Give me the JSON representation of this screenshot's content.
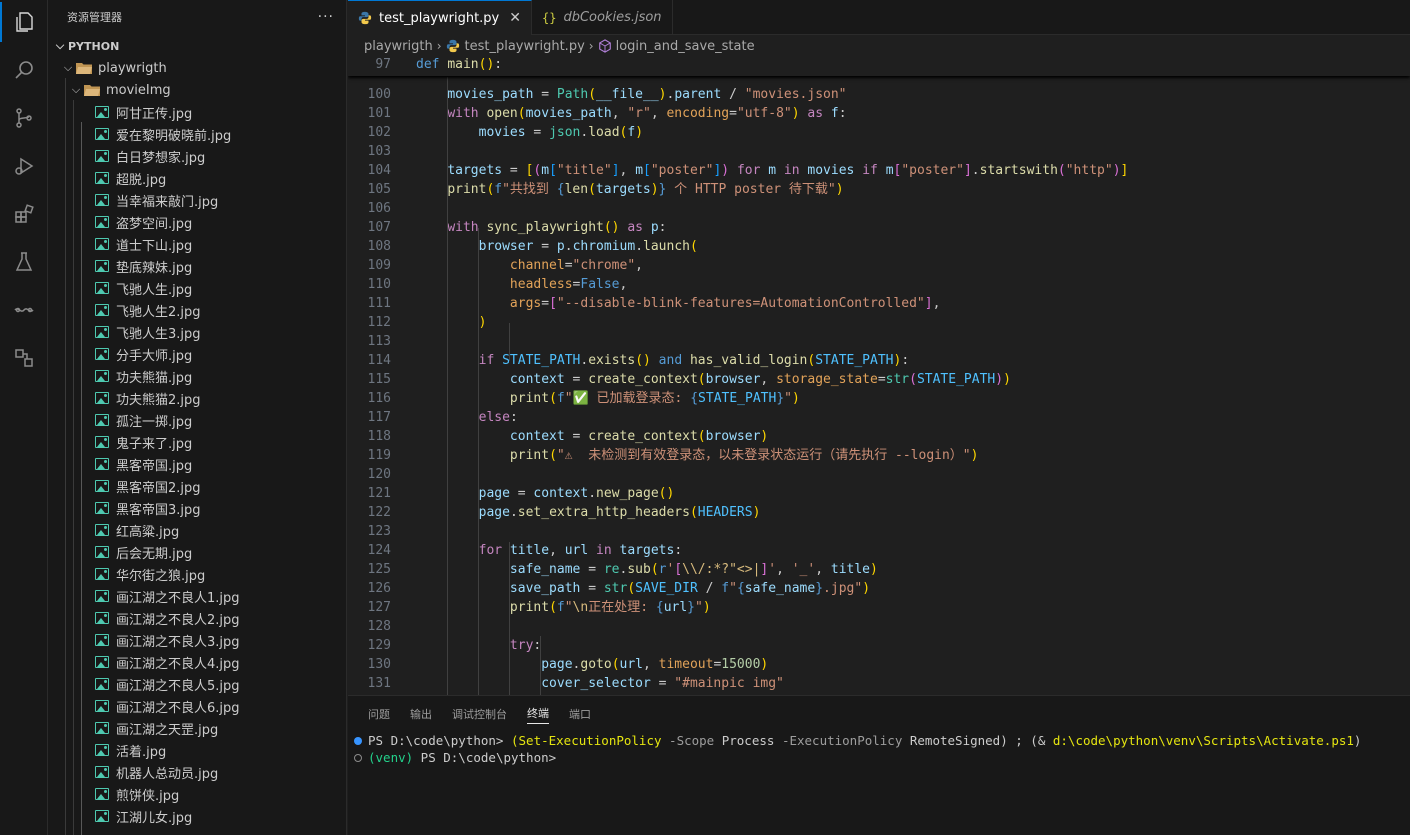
{
  "sidebar": {
    "title": "资源管理器",
    "more": "···",
    "section": "PYTHON",
    "folder": "playwrigth",
    "subfolder": "movieImg",
    "files": [
      "阿甘正传.jpg",
      "爱在黎明破晓前.jpg",
      "白日梦想家.jpg",
      "超脱.jpg",
      "当幸福来敲门.jpg",
      "盗梦空间.jpg",
      "道士下山.jpg",
      "垫底辣妹.jpg",
      "飞驰人生.jpg",
      "飞驰人生2.jpg",
      "飞驰人生3.jpg",
      "分手大师.jpg",
      "功夫熊猫.jpg",
      "功夫熊猫2.jpg",
      "孤注一掷.jpg",
      "鬼子来了.jpg",
      "黑客帝国.jpg",
      "黑客帝国2.jpg",
      "黑客帝国3.jpg",
      "红高粱.jpg",
      "后会无期.jpg",
      "华尔街之狼.jpg",
      "画江湖之不良人1.jpg",
      "画江湖之不良人2.jpg",
      "画江湖之不良人3.jpg",
      "画江湖之不良人4.jpg",
      "画江湖之不良人5.jpg",
      "画江湖之不良人6.jpg",
      "画江湖之天罡.jpg",
      "活着.jpg",
      "机器人总动员.jpg",
      "煎饼侠.jpg",
      "江湖儿女.jpg"
    ]
  },
  "tabs": [
    {
      "label": "test_playwright.py",
      "close": "✕"
    },
    {
      "label": "dbCookies.json",
      "icon": "{}"
    }
  ],
  "breadcrumb": {
    "folder": "playwrigth",
    "file": "test_playwright.py",
    "symbol": "login_and_save_state"
  },
  "editor": {
    "sticky": {
      "num": "97",
      "html": "<span class='kwb'>def</span> <span class='fn'>main</span><span class='b1'>()</span>:"
    },
    "lines": [
      {
        "num": "100",
        "html": "    <span class='var'>movies_path</span> = <span class='cls'>Path</span><span class='b1'>(</span><span class='var'>__file__</span><span class='b1'>)</span>.<span class='var'>parent</span> / <span class='str'>\"movies.json\"</span>"
      },
      {
        "num": "101",
        "html": "    <span class='kw'>with</span> <span class='fn'>open</span><span class='b1'>(</span><span class='var'>movies_path</span>, <span class='str'>\"r\"</span>, <span class='prm'>encoding</span>=<span class='str'>\"utf-8\"</span><span class='b1'>)</span> <span class='kw'>as</span> <span class='var'>f</span>:"
      },
      {
        "num": "102",
        "html": "        <span class='var'>movies</span> = <span class='cls'>json</span>.<span class='fn'>load</span><span class='b1'>(</span><span class='var'>f</span><span class='b1'>)</span>"
      },
      {
        "num": "103",
        "html": ""
      },
      {
        "num": "104",
        "html": "    <span class='var'>targets</span> = <span class='b1'>[</span><span class='b2'>(</span><span class='var'>m</span><span class='b3'>[</span><span class='str'>\"title\"</span><span class='b3'>]</span>, <span class='var'>m</span><span class='b3'>[</span><span class='str'>\"poster\"</span><span class='b3'>]</span><span class='b2'>)</span> <span class='kw'>for</span> <span class='var'>m</span> <span class='kw'>in</span> <span class='var'>movies</span> <span class='kw'>if</span> <span class='var'>m</span><span class='b2'>[</span><span class='str'>\"poster\"</span><span class='b2'>]</span>.<span class='fn'>startswith</span><span class='b2'>(</span><span class='str'>\"http\"</span><span class='b2'>)</span><span class='b1'>]</span>"
      },
      {
        "num": "105",
        "html": "    <span class='fn'>print</span><span class='b1'>(</span><span class='kwb'>f</span><span class='str'>\"共找到 </span><span class='kwb'>{</span><span class='fn'>len</span><span class='b1'>(</span><span class='var'>targets</span><span class='b1'>)</span><span class='kwb'>}</span><span class='str'> 个 HTTP poster 待下载\"</span><span class='b1'>)</span>"
      },
      {
        "num": "106",
        "html": ""
      },
      {
        "num": "107",
        "html": "    <span class='kw'>with</span> <span class='fn'>sync_playwright</span><span class='b1'>()</span> <span class='kw'>as</span> <span class='var'>p</span>:"
      },
      {
        "num": "108",
        "html": "        <span class='var'>browser</span> = <span class='var'>p</span>.<span class='var'>chromium</span>.<span class='fn'>launch</span><span class='b1'>(</span>"
      },
      {
        "num": "109",
        "html": "            <span class='prm'>channel</span>=<span class='str'>\"chrome\"</span>,"
      },
      {
        "num": "110",
        "html": "            <span class='prm'>headless</span>=<span class='kwb'>False</span>,"
      },
      {
        "num": "111",
        "html": "            <span class='prm'>args</span>=<span class='b2'>[</span><span class='str'>\"--disable-blink-features=AutomationControlled\"</span><span class='b2'>]</span>,"
      },
      {
        "num": "112",
        "html": "        <span class='b1'>)</span>"
      },
      {
        "num": "113",
        "html": ""
      },
      {
        "num": "114",
        "html": "        <span class='kw'>if</span> <span class='const'>STATE_PATH</span>.<span class='fn'>exists</span><span class='b1'>()</span> <span class='kwb'>and</span> <span class='fn'>has_valid_login</span><span class='b1'>(</span><span class='const'>STATE_PATH</span><span class='b1'>)</span>:"
      },
      {
        "num": "115",
        "html": "            <span class='var'>context</span> = <span class='fn'>create_context</span><span class='b1'>(</span><span class='var'>browser</span>, <span class='prm'>storage_state</span>=<span class='cls'>str</span><span class='b2'>(</span><span class='const'>STATE_PATH</span><span class='b2'>)</span><span class='b1'>)</span>"
      },
      {
        "num": "116",
        "html": "            <span class='fn'>print</span><span class='b1'>(</span><span class='kwb'>f</span><span class='str'>\"✅ 已加载登录态: </span><span class='kwb'>{</span><span class='const'>STATE_PATH</span><span class='kwb'>}</span><span class='str'>\"</span><span class='b1'>)</span>"
      },
      {
        "num": "117",
        "html": "        <span class='kw'>else</span>:"
      },
      {
        "num": "118",
        "html": "            <span class='var'>context</span> = <span class='fn'>create_context</span><span class='b1'>(</span><span class='var'>browser</span><span class='b1'>)</span>"
      },
      {
        "num": "119",
        "html": "            <span class='fn'>print</span><span class='b1'>(</span><span class='str'>\"⚠  未检测到有效登录态，以未登录状态运行（请先执行 --login）\"</span><span class='b1'>)</span>"
      },
      {
        "num": "120",
        "html": ""
      },
      {
        "num": "121",
        "html": "        <span class='var'>page</span> = <span class='var'>context</span>.<span class='fn'>new_page</span><span class='b1'>()</span>"
      },
      {
        "num": "122",
        "html": "        <span class='var'>page</span>.<span class='fn'>set_extra_http_headers</span><span class='b1'>(</span><span class='const'>HEADERS</span><span class='b1'>)</span>"
      },
      {
        "num": "123",
        "html": ""
      },
      {
        "num": "124",
        "html": "        <span class='kw'>for</span> <span class='var'>title</span>, <span class='var'>url</span> <span class='kw'>in</span> <span class='var'>targets</span>:"
      },
      {
        "num": "125",
        "html": "            <span class='var'>safe_name</span> = <span class='cls'>re</span>.<span class='fn'>sub</span><span class='b1'>(</span><span class='kwb'>r</span><span class='str'>'</span><span class='b2'>[</span><span class='esc'>\\\\/:*?\"&lt;&gt;|</span><span class='b2'>]</span><span class='str'>'</span>, <span class='str'>'_'</span>, <span class='var'>title</span><span class='b1'>)</span>"
      },
      {
        "num": "126",
        "html": "            <span class='var'>save_path</span> = <span class='cls'>str</span><span class='b1'>(</span><span class='const'>SAVE_DIR</span> / <span class='kwb'>f</span><span class='str'>\"</span><span class='kwb'>{</span><span class='var'>safe_name</span><span class='kwb'>}</span><span class='str'>.jpg\"</span><span class='b1'>)</span>"
      },
      {
        "num": "127",
        "html": "            <span class='fn'>print</span><span class='b1'>(</span><span class='kwb'>f</span><span class='str'>\"</span><span class='esc'>\\n</span><span class='str'>正在处理: </span><span class='kwb'>{</span><span class='var'>url</span><span class='kwb'>}</span><span class='str'>\"</span><span class='b1'>)</span>"
      },
      {
        "num": "128",
        "html": ""
      },
      {
        "num": "129",
        "html": "            <span class='kw'>try</span>:"
      },
      {
        "num": "130",
        "html": "                <span class='var'>page</span>.<span class='fn'>goto</span><span class='b1'>(</span><span class='var'>url</span>, <span class='prm'>timeout</span>=<span class='num'>15000</span><span class='b1'>)</span>"
      },
      {
        "num": "131",
        "html": "                <span class='var'>cover_selector</span> = <span class='str'>\"#mainpic img\"</span>"
      }
    ]
  },
  "panel": {
    "tabs": [
      "问题",
      "输出",
      "调试控制台",
      "终端",
      "端口"
    ],
    "active_tab": "终端",
    "terminal": [
      {
        "html": "PS D:\\code\\python&gt; <span class='t-y'>(Set-ExecutionPolicy</span> <span class='t-d'>-Scope</span> Process <span class='t-d'>-ExecutionPolicy</span> RemoteSigned) ; (&amp; <span class='t-y'>d:\\code\\python\\venv\\Scripts\\Activate.ps1</span>)"
      },
      {
        "html": "<span class='t-g'>(venv)</span> PS D:\\code\\python&gt;"
      }
    ]
  },
  "colors": {
    "accent": "#0078d4",
    "editor_bg": "#1f1f1f",
    "sidebar_bg": "#181818"
  }
}
